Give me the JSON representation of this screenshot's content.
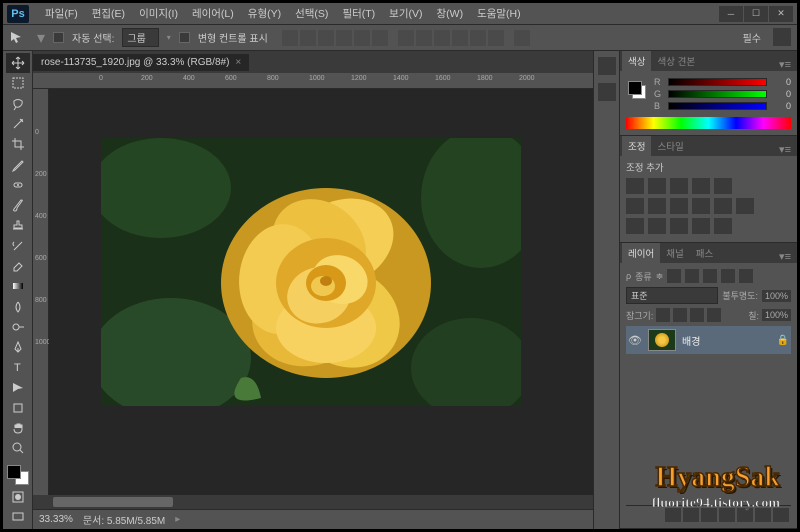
{
  "app": {
    "logo": "Ps"
  },
  "menus": [
    "파일(F)",
    "편집(E)",
    "이미지(I)",
    "레이어(L)",
    "유형(Y)",
    "선택(S)",
    "필터(T)",
    "보기(V)",
    "창(W)",
    "도움말(H)"
  ],
  "optbar": {
    "autosel_label": "자동 선택:",
    "autosel_value": "그룹",
    "transform_label": "변형 컨트롤 표시",
    "essential": "필수"
  },
  "doc": {
    "tab_title": "rose-113735_1920.jpg @ 33.3% (RGB/8#)",
    "zoom": "33.33%",
    "status": "문서: 5.85M/5.85M"
  },
  "ruler_h": [
    "0",
    "200",
    "400",
    "600",
    "800",
    "1000",
    "1200",
    "1400",
    "1600",
    "1800",
    "2000"
  ],
  "ruler_v": [
    "0",
    "200",
    "400",
    "600",
    "800",
    "1000"
  ],
  "panels": {
    "color": {
      "tab1": "색상",
      "tab2": "색상 견본",
      "r": "R",
      "g": "G",
      "b": "B",
      "rv": "0",
      "gv": "0",
      "bv": "0"
    },
    "adjust": {
      "tab1": "조정",
      "tab2": "스타일",
      "add": "조정 추가"
    },
    "layers": {
      "tab1": "레이어",
      "tab2": "채널",
      "tab3": "패스",
      "kind": "종류",
      "blend": "표준",
      "opacity_label": "불투명도:",
      "opacity": "100%",
      "lock_label": "잠그기:",
      "fill_label": "칠:",
      "fill": "100%",
      "layer_name": "배경"
    }
  },
  "watermark": {
    "title": "HyangSak",
    "sub": "fluorite94.tistory.com"
  }
}
